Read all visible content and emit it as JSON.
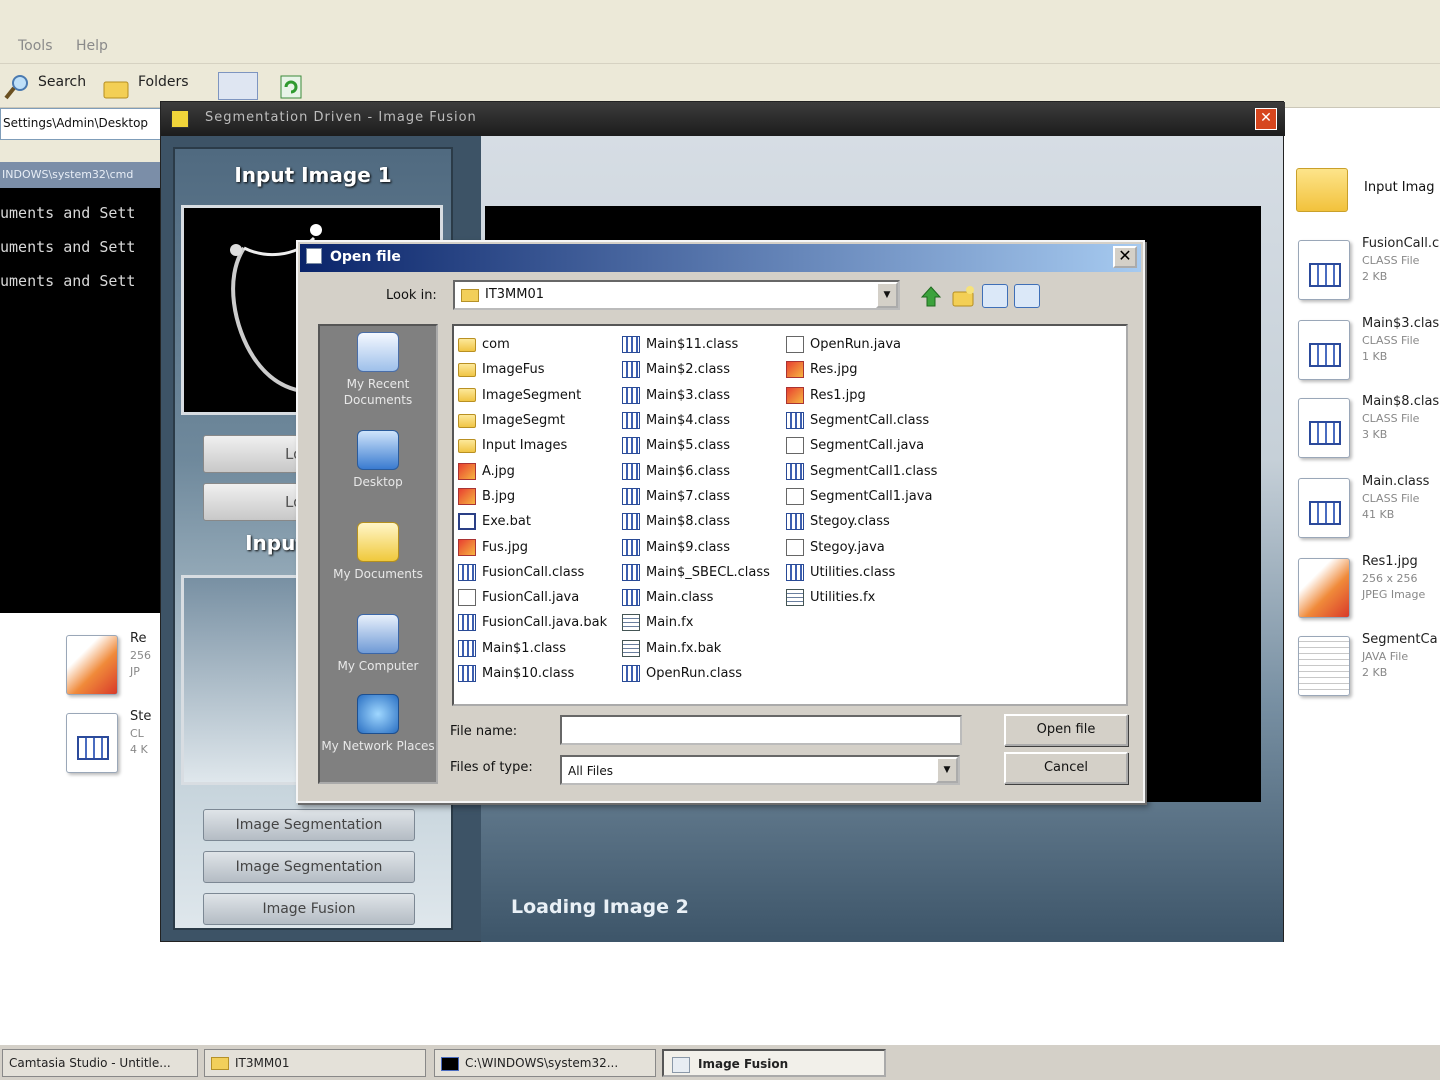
{
  "explorer": {
    "menu": [
      "Tools",
      "Help"
    ],
    "toolbar": {
      "search": "Search",
      "folders": "Folders"
    },
    "address": "Settings\\Admin\\Desktop",
    "cmd_title": "INDOWS\\system32\\cmd",
    "cmd_lines": [
      "uments and Sett",
      "uments and Sett",
      "uments and Sett"
    ],
    "right_items": [
      {
        "name": "Input Imag",
        "type": "",
        "size": ""
      },
      {
        "name": "FusionCall.c",
        "type": "CLASS File",
        "size": "2 KB"
      },
      {
        "name": "Main$3.clas",
        "type": "CLASS File",
        "size": "1 KB"
      },
      {
        "name": "Main$8.clas",
        "type": "CLASS File",
        "size": "3 KB"
      },
      {
        "name": "Main.class",
        "type": "CLASS File",
        "size": "41 KB"
      },
      {
        "name": "Res1.jpg",
        "type": "256 x 256",
        "size": "JPEG Image"
      },
      {
        "name": "SegmentCa",
        "type": "JAVA File",
        "size": "2 KB"
      }
    ],
    "left_items": [
      {
        "name": "Re",
        "type": "256",
        "size": "JP"
      },
      {
        "name": "Ste",
        "type": "CL",
        "size": "4 K"
      }
    ]
  },
  "fusion": {
    "title": "Segmentation Driven - Image Fusion",
    "input_image_1": "Input Image 1",
    "input_image_2": "Input",
    "load_button_1": "Load",
    "load_button_2": "Load",
    "seg_button_1": "Image Segmentation",
    "seg_button_2": "Image Segmentation",
    "fusion_button": "Image Fusion",
    "status": "Loading Image 2"
  },
  "dialog": {
    "title": "Open file",
    "look_in_label": "Look in:",
    "look_in_value": "IT3MM01",
    "places": [
      "My Recent Documents",
      "Desktop",
      "My Documents",
      "My Computer",
      "My Network Places"
    ],
    "files_col1": [
      {
        "name": "com",
        "kind": "folder"
      },
      {
        "name": "ImageFus",
        "kind": "folder"
      },
      {
        "name": "ImageSegment",
        "kind": "folder"
      },
      {
        "name": "ImageSegmt",
        "kind": "folder"
      },
      {
        "name": "Input Images",
        "kind": "folder"
      },
      {
        "name": "A.jpg",
        "kind": "jpg"
      },
      {
        "name": "B.jpg",
        "kind": "jpg"
      },
      {
        "name": "Exe.bat",
        "kind": "bat"
      },
      {
        "name": "Fus.jpg",
        "kind": "jpg"
      },
      {
        "name": "FusionCall.class",
        "kind": "cls"
      },
      {
        "name": "FusionCall.java",
        "kind": "java"
      },
      {
        "name": "FusionCall.java.bak",
        "kind": "cls"
      },
      {
        "name": "Main$1.class",
        "kind": "cls"
      },
      {
        "name": "Main$10.class",
        "kind": "cls"
      }
    ],
    "files_col2": [
      {
        "name": "Main$11.class",
        "kind": "cls"
      },
      {
        "name": "Main$2.class",
        "kind": "cls"
      },
      {
        "name": "Main$3.class",
        "kind": "cls"
      },
      {
        "name": "Main$4.class",
        "kind": "cls"
      },
      {
        "name": "Main$5.class",
        "kind": "cls"
      },
      {
        "name": "Main$6.class",
        "kind": "cls"
      },
      {
        "name": "Main$7.class",
        "kind": "cls"
      },
      {
        "name": "Main$8.class",
        "kind": "cls"
      },
      {
        "name": "Main$9.class",
        "kind": "cls"
      },
      {
        "name": "Main$_SBECL.class",
        "kind": "cls"
      },
      {
        "name": "Main.class",
        "kind": "cls"
      },
      {
        "name": "Main.fx",
        "kind": "fx"
      },
      {
        "name": "Main.fx.bak",
        "kind": "fx"
      },
      {
        "name": "OpenRun.class",
        "kind": "cls"
      }
    ],
    "files_col3": [
      {
        "name": "OpenRun.java",
        "kind": "java"
      },
      {
        "name": "Res.jpg",
        "kind": "jpg"
      },
      {
        "name": "Res1.jpg",
        "kind": "jpg"
      },
      {
        "name": "SegmentCall.class",
        "kind": "cls"
      },
      {
        "name": "SegmentCall.java",
        "kind": "java"
      },
      {
        "name": "SegmentCall1.class",
        "kind": "cls"
      },
      {
        "name": "SegmentCall1.java",
        "kind": "java"
      },
      {
        "name": "Stegoy.class",
        "kind": "cls"
      },
      {
        "name": "Stegoy.java",
        "kind": "java"
      },
      {
        "name": "Utilities.class",
        "kind": "cls"
      },
      {
        "name": "Utilities.fx",
        "kind": "fx"
      }
    ],
    "file_name_label": "File name:",
    "file_name_value": "",
    "files_of_type_label": "Files of type:",
    "files_of_type_value": "All Files",
    "open_button": "Open file",
    "cancel_button": "Cancel"
  },
  "taskbar": [
    {
      "label": "Camtasia Studio - Untitle...",
      "active": false
    },
    {
      "label": "IT3MM01",
      "active": false
    },
    {
      "label": "C:\\WINDOWS\\system32...",
      "active": false
    },
    {
      "label": "Image Fusion",
      "active": true
    }
  ]
}
